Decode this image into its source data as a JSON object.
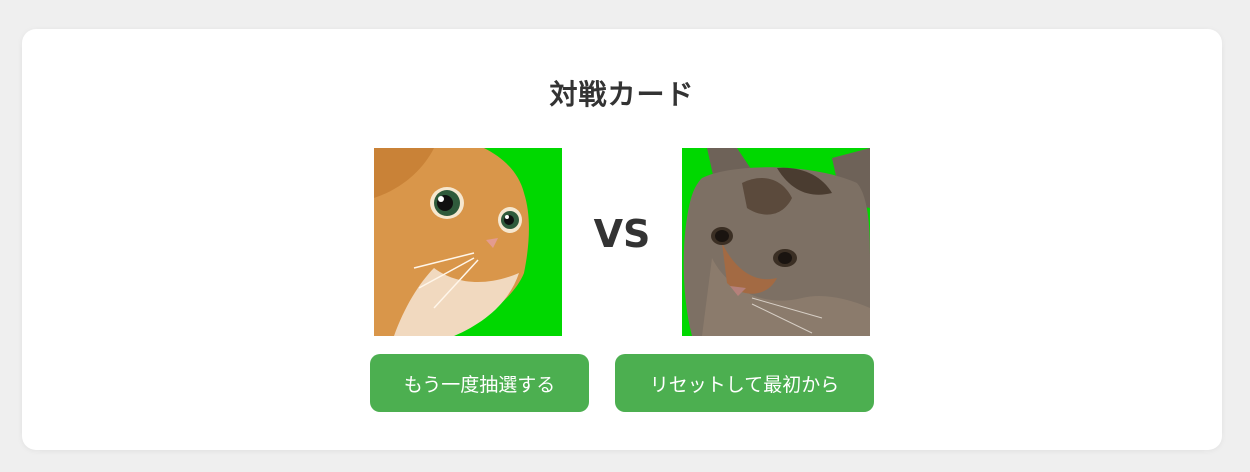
{
  "title": "対戦カード",
  "vs_label": "VS",
  "buttons": {
    "retry_label": "もう一度抽選する",
    "reset_label": "リセットして最初から"
  },
  "colors": {
    "button": "#4caf50",
    "portrait_background": "#00d800",
    "page_background": "#efefef",
    "text": "#333333"
  }
}
